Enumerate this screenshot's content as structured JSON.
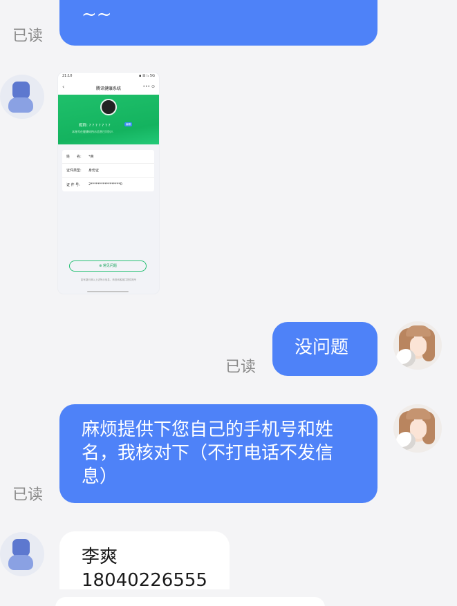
{
  "messages": {
    "top_sent": {
      "text": "~~",
      "read": "已读"
    },
    "received_image": {
      "screenshot": {
        "status_time": "21:10",
        "status_icons": "▪ ☰ ⁞ᵢₗ 5G",
        "nav_title": "腾讯健康系统",
        "nickname_line": "昵称: ? ? ? ? ? ? ?",
        "badge": "编辑",
        "subtext": "本账号在健康码所示信息已识别人",
        "rows": [
          {
            "key": "姓　　名:",
            "value": "*爽"
          },
          {
            "key": "证件类型:",
            "value": "身份证"
          },
          {
            "key": "证 件 号:",
            "value": "2*****************0"
          }
        ],
        "help_button": "⊕ 常见问题",
        "footer_text": "如有疑问请以上述所示信息，请咨询客服并提供账号"
      }
    },
    "sent_ok": {
      "text": "没问题",
      "read": "已读"
    },
    "sent_request": {
      "text": "麻烦提供下您自己的手机号和姓名，我核对下（不打电话不发信息）",
      "read": "已读"
    },
    "received_info": {
      "name": "李爽",
      "phone": "18040226555"
    }
  },
  "colors": {
    "bubble_blue": "#4e82f8",
    "page_bg": "#f4f4f6",
    "health_green": "#14b35f"
  },
  "icons": {
    "received_avatar": "default-user-avatar",
    "sent_avatar": "girl-with-cat-avatar"
  }
}
